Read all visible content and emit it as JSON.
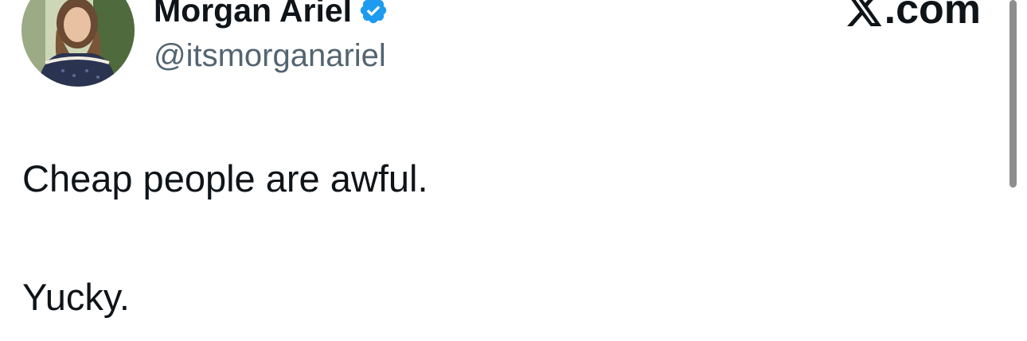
{
  "author": {
    "display_name": "Morgan Ariel",
    "handle": "@itsmorganariel",
    "verified": true,
    "verified_color": "#1d9bf0",
    "avatar_icon": "profile-photo"
  },
  "brand": {
    "icon": "x-logo-icon",
    "suffix": ".com"
  },
  "tweet": {
    "lines": [
      "Cheap people are awful.",
      "Yucky."
    ]
  },
  "colors": {
    "text": "#0f1419",
    "secondary": "#536471",
    "background": "#ffffff"
  }
}
